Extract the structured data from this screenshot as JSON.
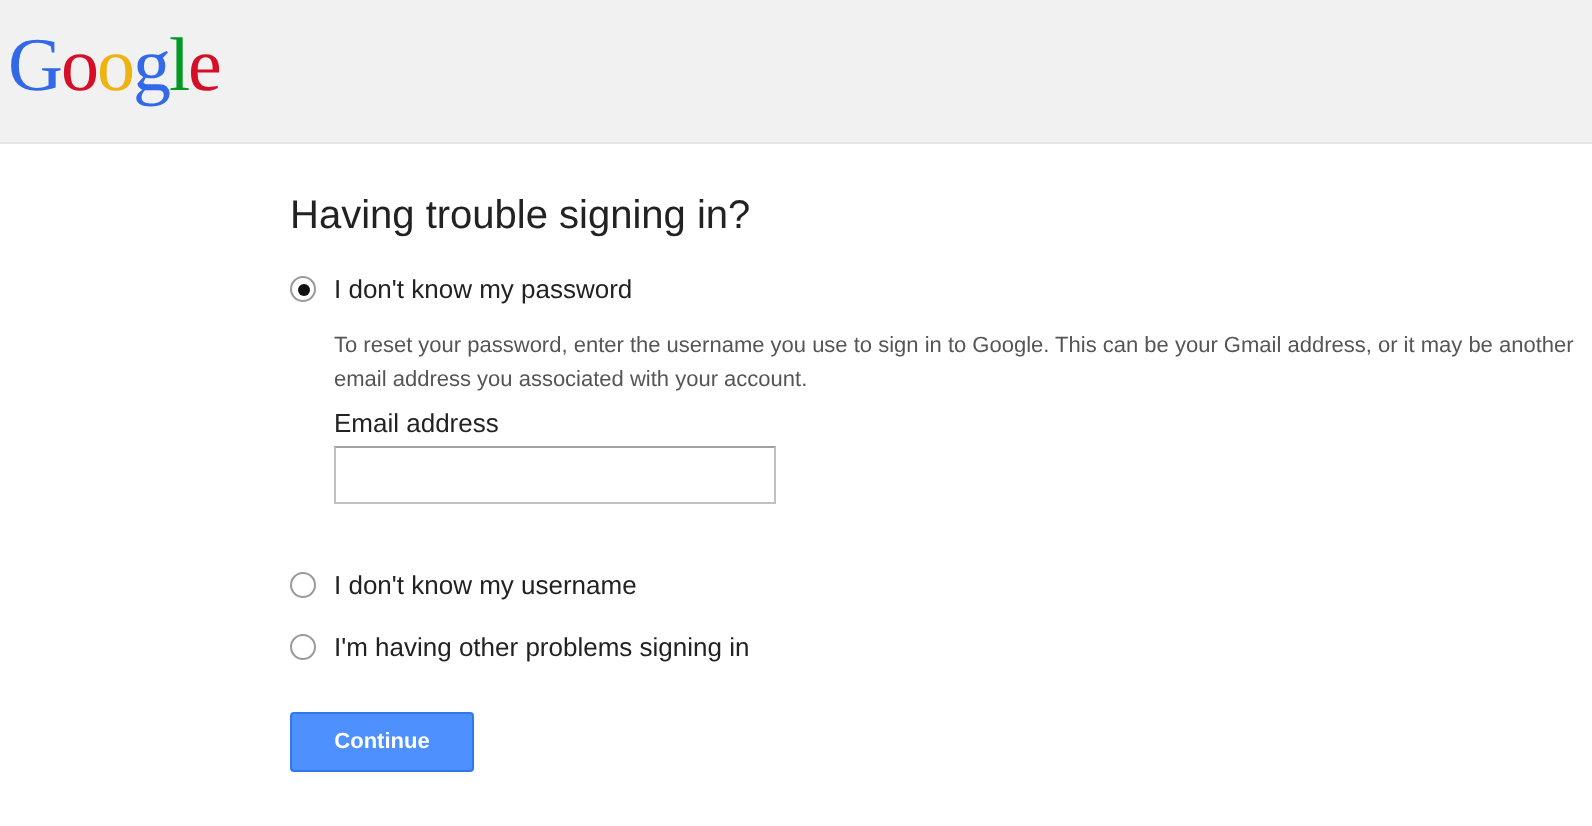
{
  "header": {
    "logo": "Google"
  },
  "title": "Having trouble signing in?",
  "options": [
    {
      "label": "I don't know my password",
      "selected": true,
      "description": "To reset your password, enter the username you use to sign in to Google. This can be your Gmail address, or it may be another email address you associated with your account.",
      "field": {
        "label": "Email address"
      }
    },
    {
      "label": "I don't know my username",
      "selected": false
    },
    {
      "label": "I'm having other problems signing in",
      "selected": false
    }
  ],
  "button": "Continue"
}
